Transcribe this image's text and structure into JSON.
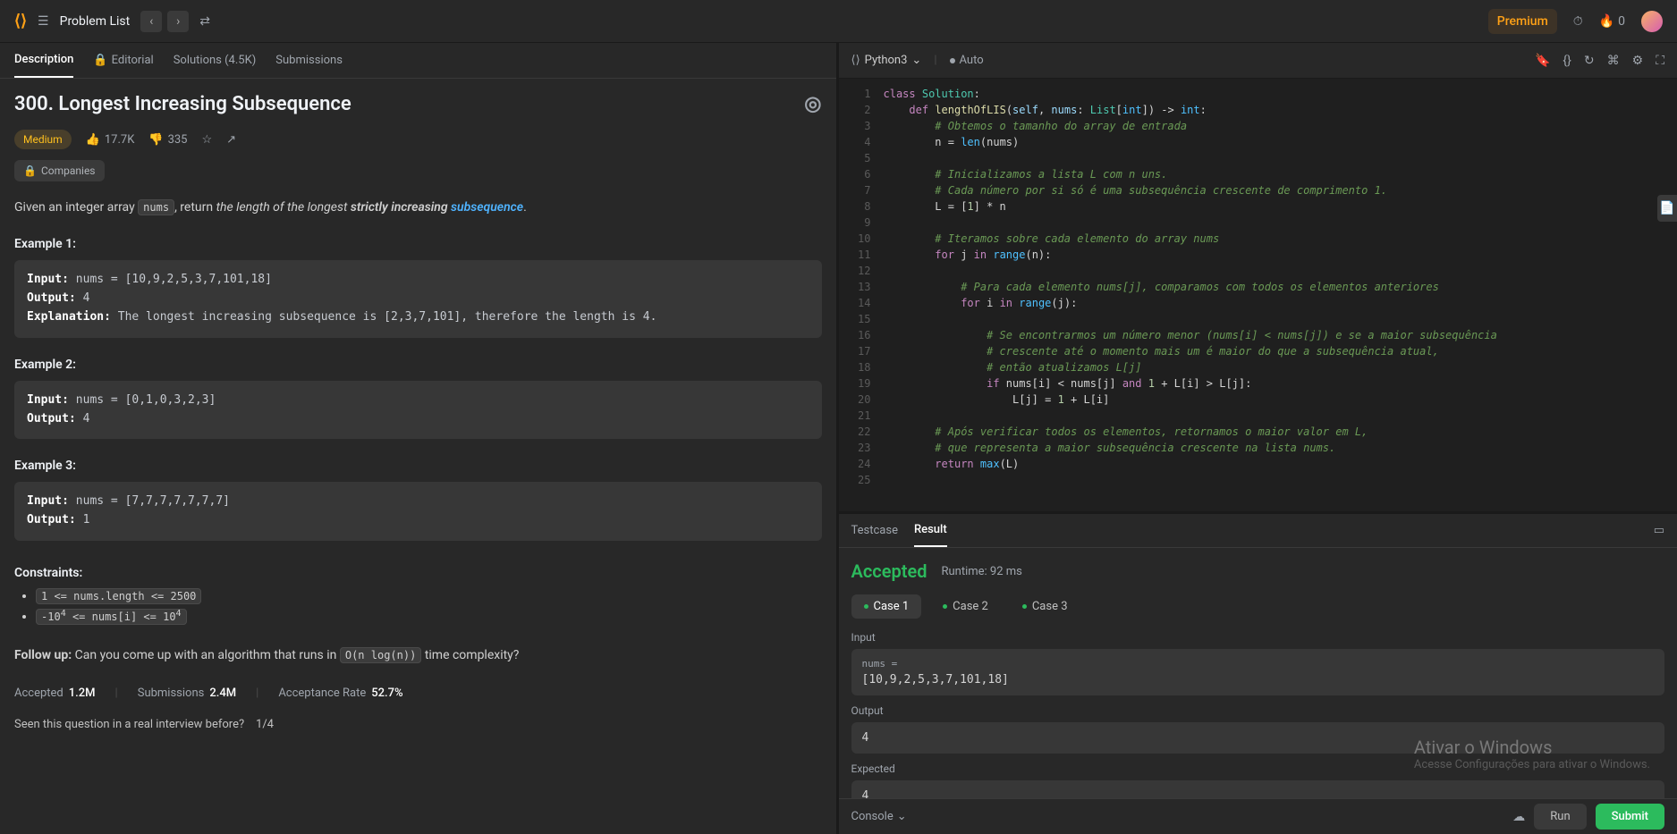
{
  "header": {
    "problem_list": "Problem List",
    "premium": "Premium",
    "streak": "0"
  },
  "left_tabs": {
    "description": "Description",
    "editorial": "Editorial",
    "solutions": "Solutions (4.5K)",
    "submissions": "Submissions"
  },
  "problem": {
    "title": "300. Longest Increasing Subsequence",
    "difficulty": "Medium",
    "likes": "17.7K",
    "dislikes": "335",
    "companies_label": "Companies",
    "desc_pre": "Given an integer array ",
    "desc_code": "nums",
    "desc_mid": ", return ",
    "desc_italic": "the length of the longest ",
    "desc_bold": "strictly increasing ",
    "desc_link": "subsequence",
    "desc_end": ".",
    "ex1_label": "Example 1:",
    "ex1_input_lbl": "Input:",
    "ex1_input": " nums = [10,9,2,5,3,7,101,18]",
    "ex1_output_lbl": "Output:",
    "ex1_output": " 4",
    "ex1_expl_lbl": "Explanation:",
    "ex1_expl": " The longest increasing subsequence is [2,3,7,101], therefore the length is 4.",
    "ex2_label": "Example 2:",
    "ex2_input": " nums = [0,1,0,3,2,3]",
    "ex2_output": " 4",
    "ex3_label": "Example 3:",
    "ex3_input": " nums = [7,7,7,7,7,7,7]",
    "ex3_output": " 1",
    "constraints_title": "Constraints:",
    "constraint1": "1 <= nums.length <= 2500",
    "constraint2_pre": "-10",
    "constraint2_sup": "4",
    "constraint2_mid": " <= nums[i] <= 10",
    "followup_lbl": "Follow up:",
    "followup_text": " Can you come up with an algorithm that runs in ",
    "followup_code": "O(n log(n))",
    "followup_end": " time complexity?",
    "accepted_lbl": "Accepted",
    "accepted_val": "1.2M",
    "subs_lbl": "Submissions",
    "subs_val": "2.4M",
    "rate_lbl": "Acceptance Rate",
    "rate_val": "52.7%",
    "interview_q": "Seen this question in a real interview before?",
    "interview_count": "1/4"
  },
  "editor": {
    "language": "Python3",
    "auto": "Auto",
    "code_lines": [
      {
        "n": 1,
        "html": "<span class='tok-kw'>class</span> <span class='tok-cls'>Solution</span>:"
      },
      {
        "n": 2,
        "html": "    <span class='tok-kw'>def</span> <span class='tok-fn'>lengthOfLIS</span>(<span class='tok-self'>self</span>, <span class='tok-self'>nums</span>: <span class='tok-cls'>List</span>[<span class='tok-builtin'>int</span>]) -&gt; <span class='tok-builtin'>int</span>:"
      },
      {
        "n": 3,
        "html": "        <span class='tok-com'># Obtemos o tamanho do array de entrada</span>"
      },
      {
        "n": 4,
        "html": "        n = <span class='tok-builtin'>len</span>(nums)"
      },
      {
        "n": 5,
        "html": ""
      },
      {
        "n": 6,
        "html": "        <span class='tok-com'># Inicializamos a lista L com n uns.</span>"
      },
      {
        "n": 7,
        "html": "        <span class='tok-com'># Cada número por si só é uma subsequência crescente de comprimento 1.</span>"
      },
      {
        "n": 8,
        "html": "        L = [<span class='tok-num'>1</span>] * n"
      },
      {
        "n": 9,
        "html": ""
      },
      {
        "n": 10,
        "html": "        <span class='tok-com'># Iteramos sobre cada elemento do array nums</span>"
      },
      {
        "n": 11,
        "html": "        <span class='tok-kw'>for</span> j <span class='tok-kw'>in</span> <span class='tok-builtin'>range</span>(n):"
      },
      {
        "n": 12,
        "html": ""
      },
      {
        "n": 13,
        "html": "            <span class='tok-com'># Para cada elemento nums[j], comparamos com todos os elementos anteriores</span>"
      },
      {
        "n": 14,
        "html": "            <span class='tok-kw'>for</span> i <span class='tok-kw'>in</span> <span class='tok-builtin'>range</span>(j):"
      },
      {
        "n": 15,
        "html": ""
      },
      {
        "n": 16,
        "html": "                <span class='tok-com'># Se encontrarmos um número menor (nums[i] &lt; nums[j]) e se a maior subsequência</span>"
      },
      {
        "n": 17,
        "html": "                <span class='tok-com'># crescente até o momento mais um é maior do que a subsequência atual,</span>"
      },
      {
        "n": 18,
        "html": "                <span class='tok-com'># então atualizamos L[j]</span>"
      },
      {
        "n": 19,
        "html": "                <span class='tok-kw'>if</span> nums[i] &lt; nums[j] <span class='tok-kw'>and</span> <span class='tok-num'>1</span> + L[i] &gt; L[j]:"
      },
      {
        "n": 20,
        "html": "                    L[j] = <span class='tok-num'>1</span> + L[i]"
      },
      {
        "n": 21,
        "html": ""
      },
      {
        "n": 22,
        "html": "        <span class='tok-com'># Após verificar todos os elementos, retornamos o maior valor em L,</span>"
      },
      {
        "n": 23,
        "html": "        <span class='tok-com'># que representa a maior subsequência crescente na lista nums.</span>"
      },
      {
        "n": 24,
        "html": "        <span class='tok-kw'>return</span> <span class='tok-builtin'>max</span>(L)"
      },
      {
        "n": 25,
        "html": ""
      }
    ]
  },
  "result": {
    "testcase_tab": "Testcase",
    "result_tab": "Result",
    "status": "Accepted",
    "runtime_label": "Runtime: 92 ms",
    "cases": [
      "Case 1",
      "Case 2",
      "Case 3"
    ],
    "input_label": "Input",
    "nums_label": "nums =",
    "input_value": "[10,9,2,5,3,7,101,18]",
    "output_label": "Output",
    "output_value": "4",
    "expected_label": "Expected",
    "expected_value": "4"
  },
  "console": {
    "label": "Console",
    "run": "Run",
    "submit": "Submit"
  },
  "watermark": {
    "title": "Ativar o Windows",
    "sub": "Acesse Configurações para ativar o Windows."
  }
}
